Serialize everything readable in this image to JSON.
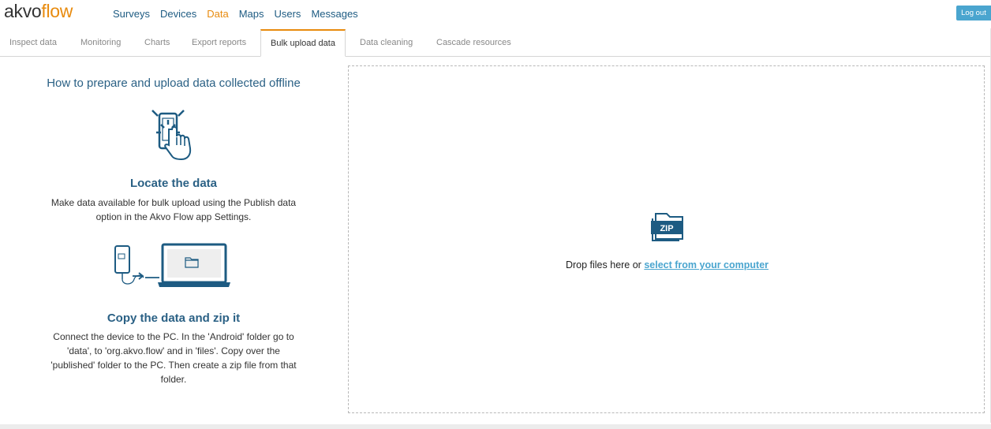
{
  "brand": {
    "part1": "akvo",
    "part2": "flow"
  },
  "nav": {
    "items": [
      {
        "label": "Surveys",
        "active": false
      },
      {
        "label": "Devices",
        "active": false
      },
      {
        "label": "Data",
        "active": true
      },
      {
        "label": "Maps",
        "active": false
      },
      {
        "label": "Users",
        "active": false
      },
      {
        "label": "Messages",
        "active": false
      }
    ],
    "logout_label": "Log out"
  },
  "subtabs": [
    {
      "label": "Inspect data"
    },
    {
      "label": "Monitoring"
    },
    {
      "label": "Charts"
    },
    {
      "label": "Export reports"
    },
    {
      "label": "Bulk upload data",
      "active": true
    },
    {
      "label": "Data cleaning"
    },
    {
      "label": "Cascade resources"
    }
  ],
  "instructions": {
    "title": "How to prepare and upload data collected offline",
    "step1": {
      "icon": "phone-tap-icon",
      "title": "Locate the data",
      "line1": "Make data available for bulk upload using the Publish data",
      "line2": "option in the Akvo Flow app Settings."
    },
    "step2": {
      "icon": "phone-to-laptop-icon",
      "title": "Copy the data and zip it",
      "line1": "Connect the device to the PC. In the 'Android' folder go to",
      "line2": "'data', to 'org.akvo.flow' and in 'files'. Copy over the",
      "line3": "'published' folder to the PC. Then create a zip file from that",
      "line4": "folder."
    }
  },
  "dropzone": {
    "icon": "zip-folder-icon",
    "zip_label": "ZIP",
    "text": "Drop files here or",
    "link": "select from your computer"
  },
  "colors": {
    "brand_orange": "#e88b0e",
    "nav_blue": "#1d5b82",
    "title_blue": "#2b6185",
    "link_blue": "#4aa5cf"
  }
}
